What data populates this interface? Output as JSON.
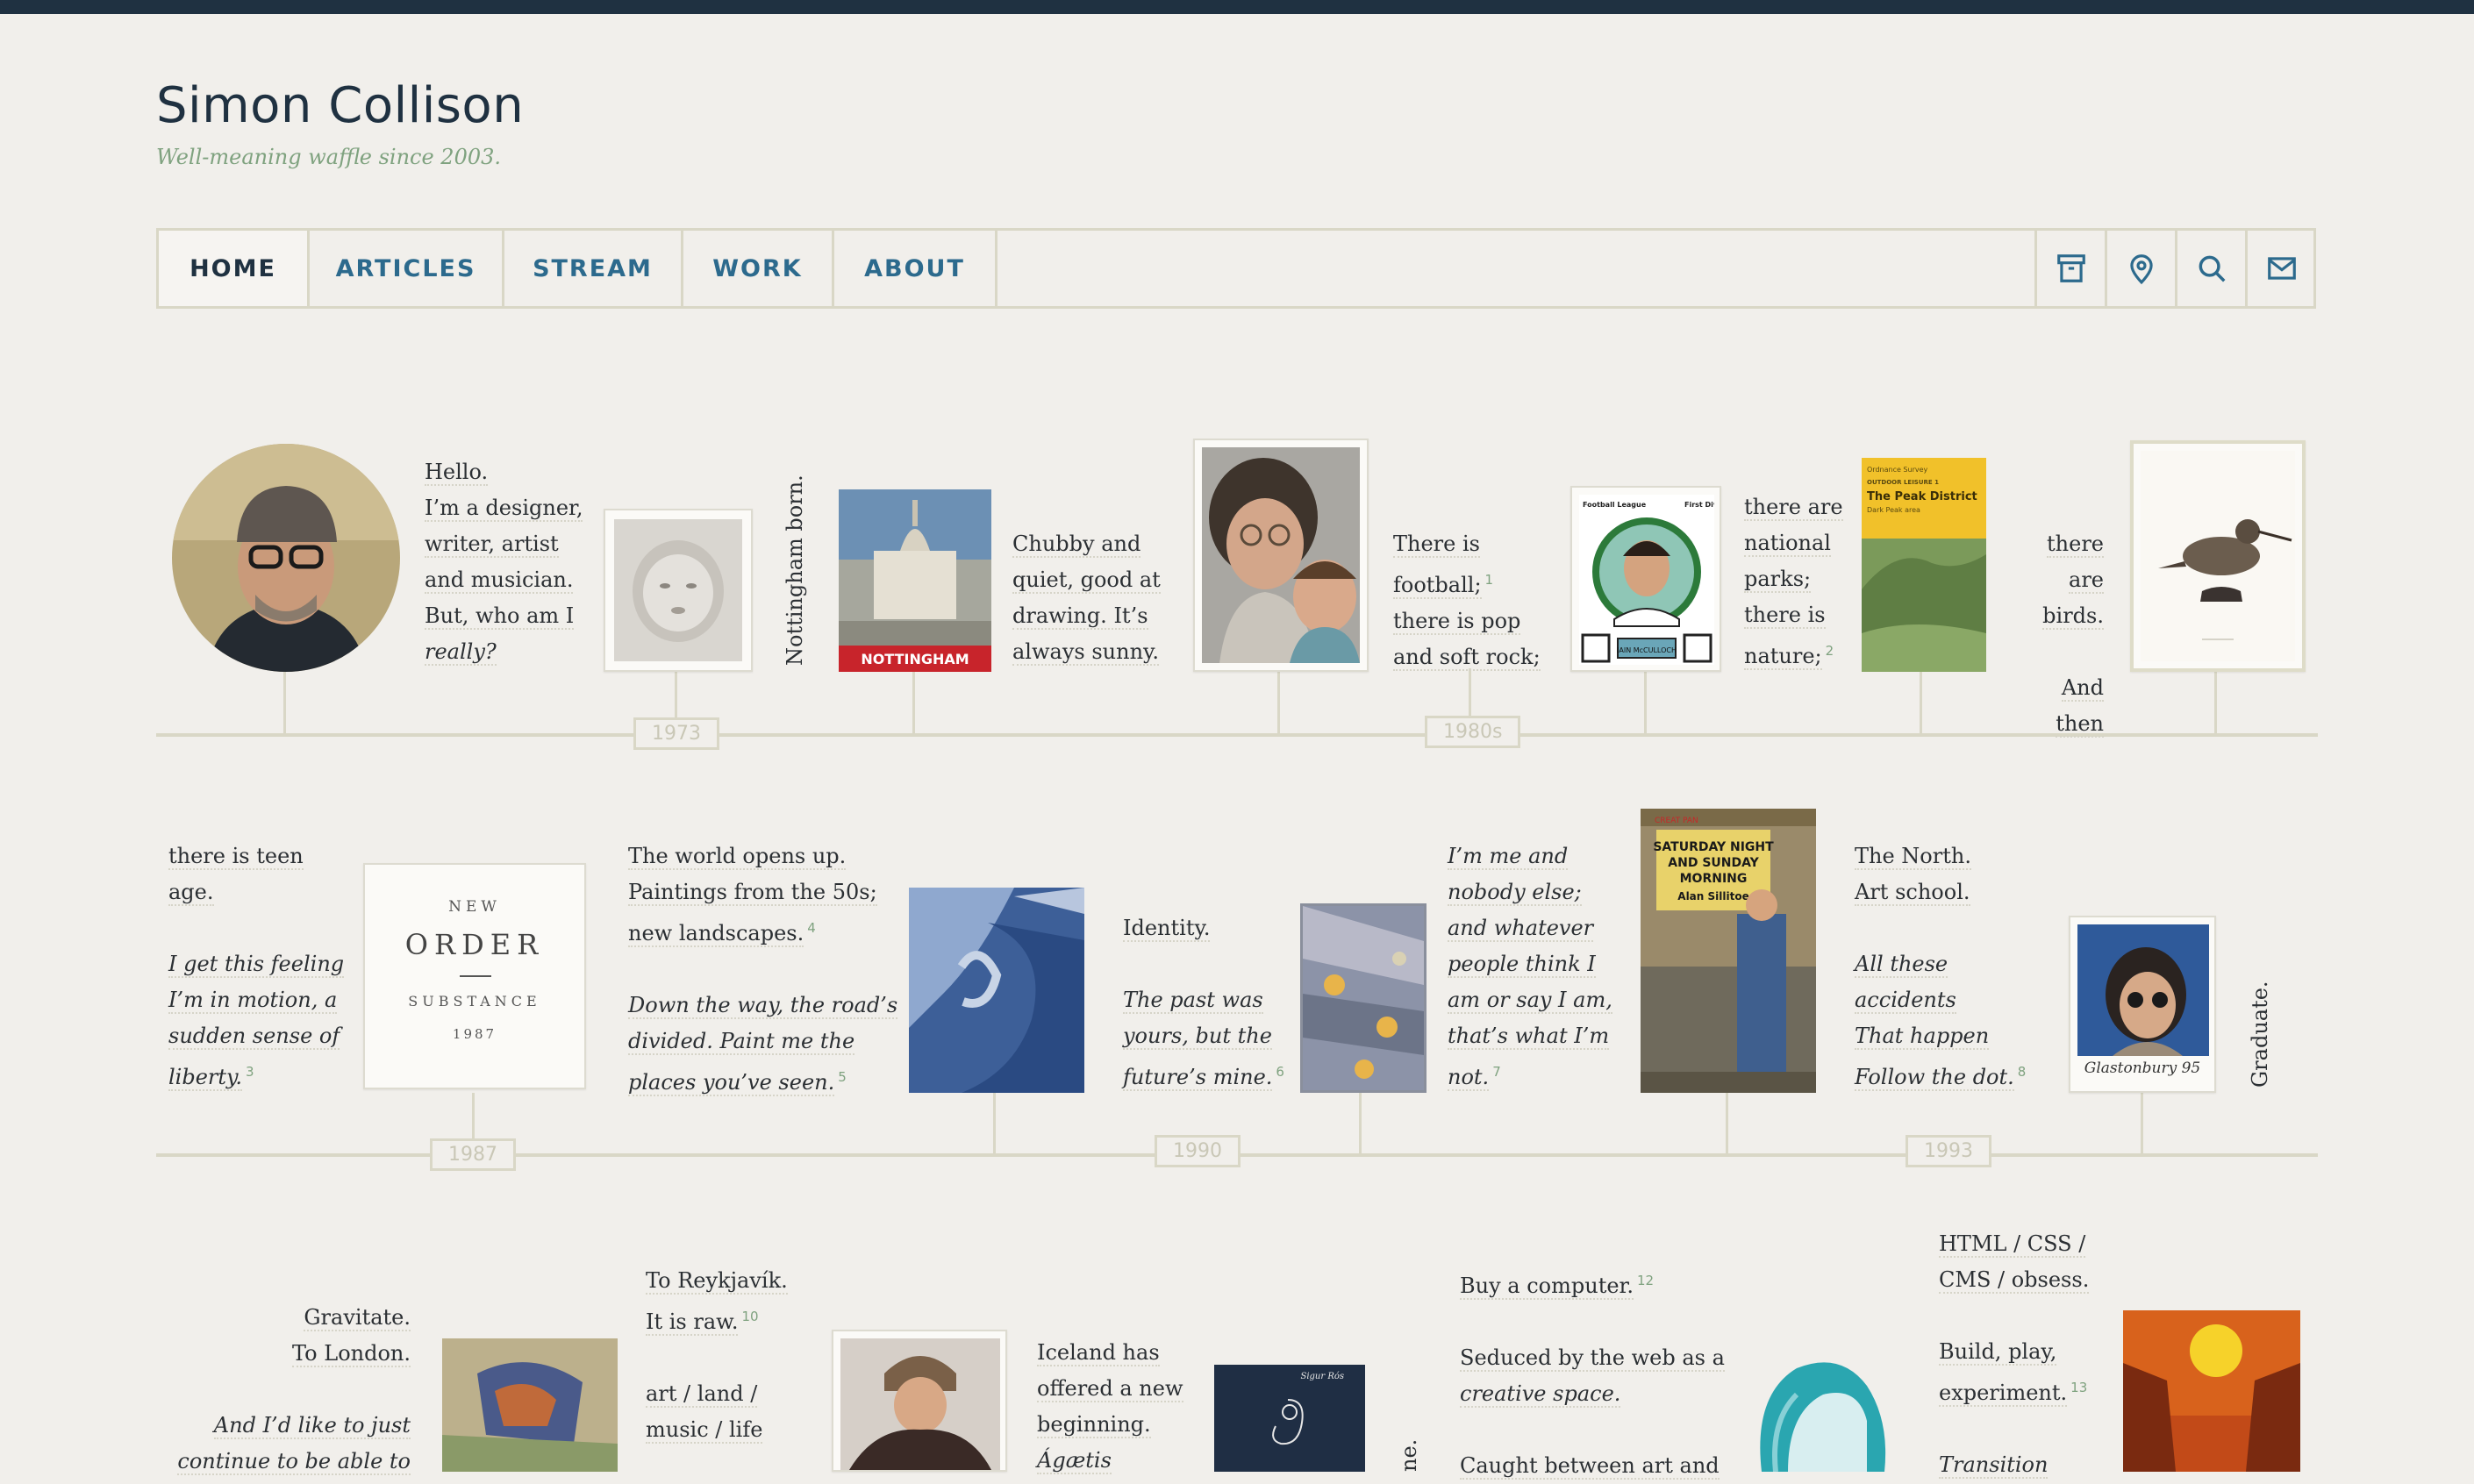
{
  "site": {
    "title": "Simon Collison",
    "tagline": "Well-meaning waffle since 2003."
  },
  "nav": {
    "items": [
      {
        "label": "HOME",
        "active": true
      },
      {
        "label": "ARTICLES",
        "active": false
      },
      {
        "label": "STREAM",
        "active": false
      },
      {
        "label": "WORK",
        "active": false
      },
      {
        "label": "ABOUT",
        "active": false
      }
    ],
    "icons": [
      "archive-icon",
      "location-pin-icon",
      "search-icon",
      "mail-icon"
    ]
  },
  "timeline": {
    "years": [
      "1973",
      "1980s",
      "1987",
      "1990",
      "1993"
    ],
    "intro": [
      "Hello.",
      "I’m a designer,",
      "writer, artist",
      "and musician.",
      "But, who am I",
      "really?"
    ],
    "born": "Nottingham born.",
    "nottingham_label": "NOTTINGHAM",
    "chubby": [
      "Chubby and",
      "quiet, good at",
      "drawing. It’s",
      "always sunny."
    ],
    "football": [
      "There is",
      "football;",
      "there is pop",
      "and soft rock;"
    ],
    "football_fn": "1",
    "card_name": "IAIN McCULLOCH",
    "card_left": "Football League",
    "card_right": "First Division",
    "parks": [
      "there are",
      "national",
      "parks;",
      "there is",
      "nature;"
    ],
    "parks_fn": "2",
    "map_publisher": "Ordnance Survey",
    "map_series": "OUTDOOR LEISURE 1",
    "map_title": "The Peak District",
    "map_subtitle": "Dark Peak area",
    "birds": [
      "there are",
      "birds."
    ],
    "and_then": "And then",
    "teen": [
      "there is teen",
      "age."
    ],
    "feeling": [
      "I get this feeling",
      "I’m in motion, a",
      "sudden sense of",
      "liberty."
    ],
    "feeling_fn": "3",
    "record_line1": "NEW",
    "record_line2": "ORDER",
    "record_line3": "SUBSTANCE",
    "record_line4": "1987",
    "world": [
      "The world opens up.",
      "Paintings from the 50s;",
      "new landscapes."
    ],
    "world_fn": "4",
    "road": [
      "Down the way, the road’s",
      "divided. Paint me the",
      "places you’ve seen."
    ],
    "road_fn": "5",
    "identity": "Identity.",
    "past": [
      "The past was",
      "yours, but the",
      "future’s mine."
    ],
    "past_fn": "6",
    "me": [
      "I’m me and",
      "nobody else;",
      "and whatever",
      "people think I",
      "am or say I am,",
      "that’s what I’m",
      "not."
    ],
    "me_fn": "7",
    "book_author_top": "CREAT PAN",
    "book_title": "SATURDAY NIGHT AND SUNDAY MORNING",
    "book_author": "Alan Sillitoe",
    "north": [
      "The North.",
      "Art school."
    ],
    "accidents": [
      "All these",
      "accidents",
      "That happen",
      "Follow the dot."
    ],
    "accidents_fn": "8",
    "polaroid_caption": "Glastonbury 95",
    "graduate": "Graduate.",
    "gravitate": [
      "Gravitate.",
      "To London."
    ],
    "continue": [
      "And I’d like to just",
      "continue to be able to"
    ],
    "reykjavik": [
      "To Reykjavík.",
      "It is raw."
    ],
    "reykjavik_fn": "10",
    "artland": [
      "art / land /",
      "music / life"
    ],
    "iceland": [
      "Iceland has",
      "offered a new",
      "beginning.",
      "Ágætis"
    ],
    "album_label": "Sigur Rós",
    "vert_partial": "ne.",
    "computer": "Buy a computer.",
    "computer_fn": "12",
    "seduced": [
      "Seduced by the web as a",
      "creative space."
    ],
    "caught": "Caught between art and",
    "html": [
      "HTML / CSS /",
      "CMS / obsess."
    ],
    "build": [
      "Build, play,",
      "experiment."
    ],
    "build_fn": "13",
    "transition": "Transition"
  },
  "colors": {
    "background": "#f1efeb",
    "navy": "#1f3141",
    "link_blue": "#2c6a8d",
    "tagline_green": "#7fa27f",
    "rule": "#d9d7c6"
  }
}
